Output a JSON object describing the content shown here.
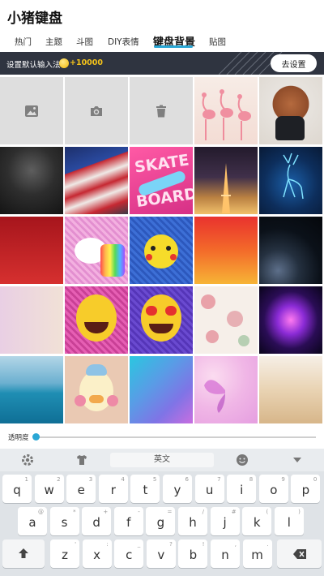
{
  "app": {
    "title": "小猪键盘"
  },
  "tabs": [
    {
      "label": "热门",
      "active": false
    },
    {
      "label": "主题",
      "active": false
    },
    {
      "label": "斗图",
      "active": false
    },
    {
      "label": "DIY表情",
      "active": false
    },
    {
      "label": "键盘背景",
      "active": true
    },
    {
      "label": "贴图",
      "active": false
    }
  ],
  "banner": {
    "text": "设置默认输入法",
    "reward": "+10000",
    "button": "去设置"
  },
  "grid": {
    "utility_items": [
      "image-icon",
      "camera-icon",
      "trash-icon"
    ]
  },
  "opacity": {
    "label": "透明度",
    "value": 0.02
  },
  "keyboard": {
    "toolbar": {
      "lang": "英文",
      "icons": [
        "gear-icon",
        "shirt-icon",
        "emoji-icon",
        "collapse-icon"
      ]
    },
    "row1": [
      {
        "k": "q",
        "s": "1"
      },
      {
        "k": "w",
        "s": "2"
      },
      {
        "k": "e",
        "s": "3"
      },
      {
        "k": "r",
        "s": "4"
      },
      {
        "k": "t",
        "s": "5"
      },
      {
        "k": "y",
        "s": "6"
      },
      {
        "k": "u",
        "s": "7"
      },
      {
        "k": "i",
        "s": "8"
      },
      {
        "k": "o",
        "s": "9"
      },
      {
        "k": "p",
        "s": "0"
      }
    ],
    "row2": [
      {
        "k": "a",
        "s": "@"
      },
      {
        "k": "s",
        "s": "*"
      },
      {
        "k": "d",
        "s": "+"
      },
      {
        "k": "f",
        "s": "-"
      },
      {
        "k": "g",
        "s": "="
      },
      {
        "k": "h",
        "s": "/"
      },
      {
        "k": "j",
        "s": "#"
      },
      {
        "k": "k",
        "s": "("
      },
      {
        "k": "l",
        "s": ")"
      }
    ],
    "row3": [
      {
        "k": "z",
        "s": "'"
      },
      {
        "k": "x",
        "s": ":"
      },
      {
        "k": "c",
        "s": "_"
      },
      {
        "k": "v",
        "s": "?"
      },
      {
        "k": "b",
        "s": "!"
      },
      {
        "k": "n",
        "s": ","
      },
      {
        "k": "m",
        "s": "."
      }
    ]
  }
}
